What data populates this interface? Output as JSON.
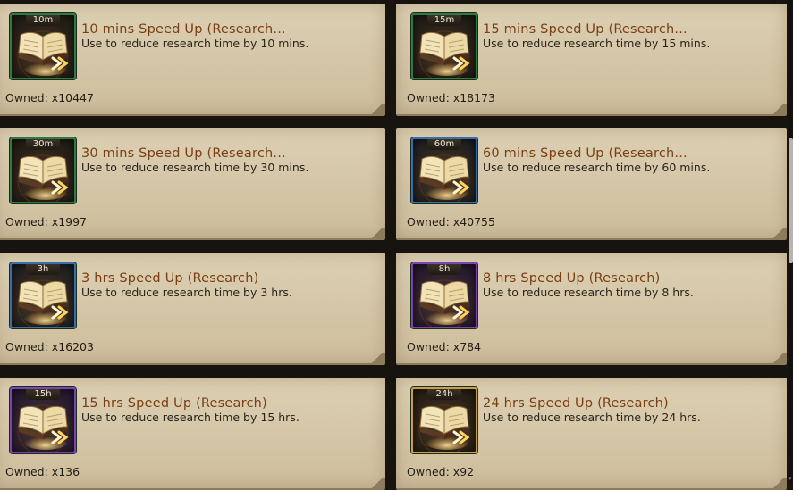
{
  "items": [
    {
      "badge": "10m",
      "title": "10 mins Speed Up (Research...",
      "desc": "Use to reduce research time by 10 mins.",
      "owned": "Owned: x10447",
      "rarity": "green"
    },
    {
      "badge": "15m",
      "title": "15 mins Speed Up (Research...",
      "desc": "Use to reduce research time by 15 mins.",
      "owned": "Owned: x18173",
      "rarity": "green"
    },
    {
      "badge": "30m",
      "title": "30 mins Speed Up (Research...",
      "desc": "Use to reduce research time by 30 mins.",
      "owned": "Owned: x1997",
      "rarity": "green"
    },
    {
      "badge": "60m",
      "title": "60 mins Speed Up (Research...",
      "desc": "Use to reduce research time by 60 mins.",
      "owned": "Owned: x40755",
      "rarity": "blue"
    },
    {
      "badge": "3h",
      "title": "3 hrs Speed Up (Research)",
      "desc": "Use to reduce research time by 3 hrs.",
      "owned": "Owned: x16203",
      "rarity": "blue"
    },
    {
      "badge": "8h",
      "title": "8 hrs Speed Up (Research)",
      "desc": "Use to reduce research time by 8 hrs.",
      "owned": "Owned: x784",
      "rarity": "purple"
    },
    {
      "badge": "15h",
      "title": "15 hrs Speed Up (Research)",
      "desc": "Use to reduce research time by 15 hrs.",
      "owned": "Owned: x136",
      "rarity": "purple"
    },
    {
      "badge": "24h",
      "title": "24 hrs Speed Up (Research)",
      "desc": "Use to reduce research time by 24 hrs.",
      "owned": "Owned: x92",
      "rarity": "gold"
    }
  ],
  "colors": {
    "card_bg": "#d8cbb0",
    "title": "#7a3e12",
    "text": "#2a241c",
    "frame_green": "#2f7a42",
    "frame_blue": "#3a6ea8",
    "frame_purple": "#7a45b0",
    "frame_gold": "#c8a048"
  },
  "icons": {
    "item": "speedup-book-icon"
  }
}
